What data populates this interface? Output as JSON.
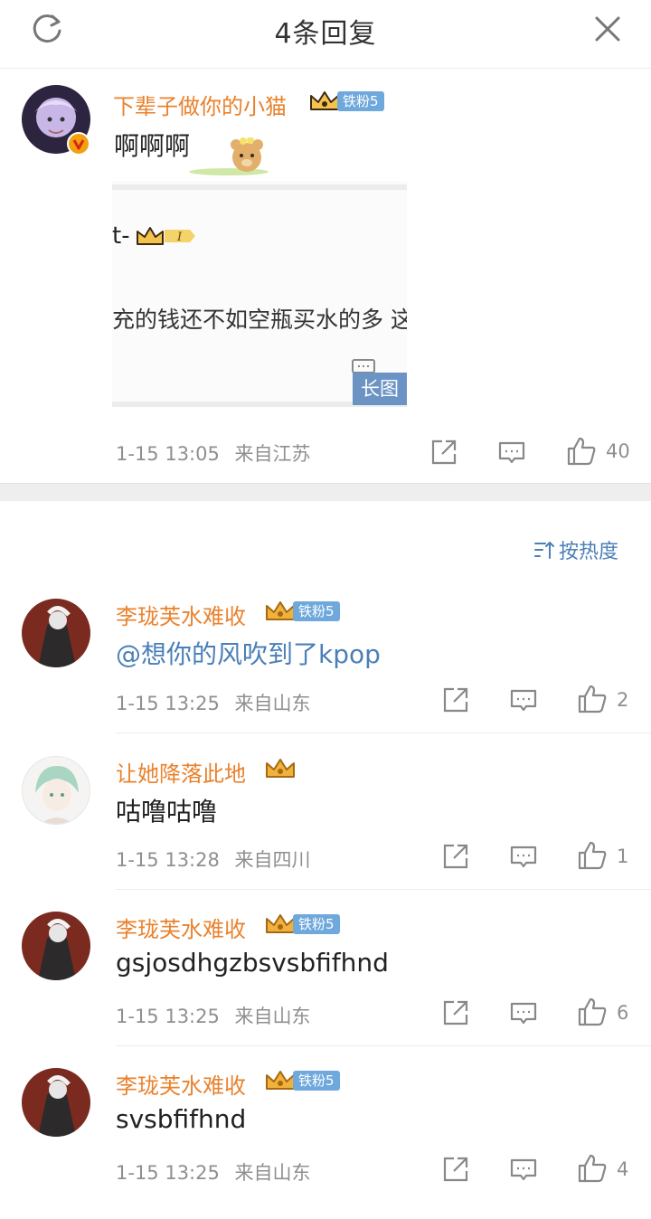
{
  "header": {
    "title": "4条回复"
  },
  "root": {
    "username": "下辈子做你的小猫",
    "fan_level": "铁粉5",
    "text": "啊啊啊",
    "long_image": {
      "fragment_name": "t-",
      "fragment_text": "充的钱还不如空瓶买水的多 这",
      "badge": "长图"
    },
    "time": "1-15 13:05",
    "location": "来自江苏",
    "likes": "40"
  },
  "sort": {
    "label": "按热度"
  },
  "replies": [
    {
      "username": "李珑芙水难收",
      "fan_level": "铁粉5",
      "text": "@想你的风吹到了kpop",
      "time": "1-15 13:25",
      "location": "来自山东",
      "likes": "2"
    },
    {
      "username": "让她降落此地",
      "fan_level": "",
      "text": "咕噜咕噜",
      "time": "1-15 13:28",
      "location": "来自四川",
      "likes": "1"
    },
    {
      "username": "李珑芙水难收",
      "fan_level": "铁粉5",
      "text": "gsjosdhgzbsvsbfifhnd",
      "time": "1-15 13:25",
      "location": "来自山东",
      "likes": "6"
    },
    {
      "username": "李珑芙水难收",
      "fan_level": "铁粉5",
      "text": "svsbfifhnd",
      "time": "1-15 13:25",
      "location": "来自山东",
      "likes": "4"
    }
  ],
  "colors": {
    "username": "#e9822e",
    "link": "#4a7fb8",
    "meta": "#8f8f8f",
    "fan_tag": "#6fa8dc"
  },
  "icons": [
    "refresh-icon",
    "close-icon",
    "verified-icon",
    "crown-icon",
    "share-icon",
    "comment-icon",
    "like-icon",
    "sort-icon"
  ]
}
